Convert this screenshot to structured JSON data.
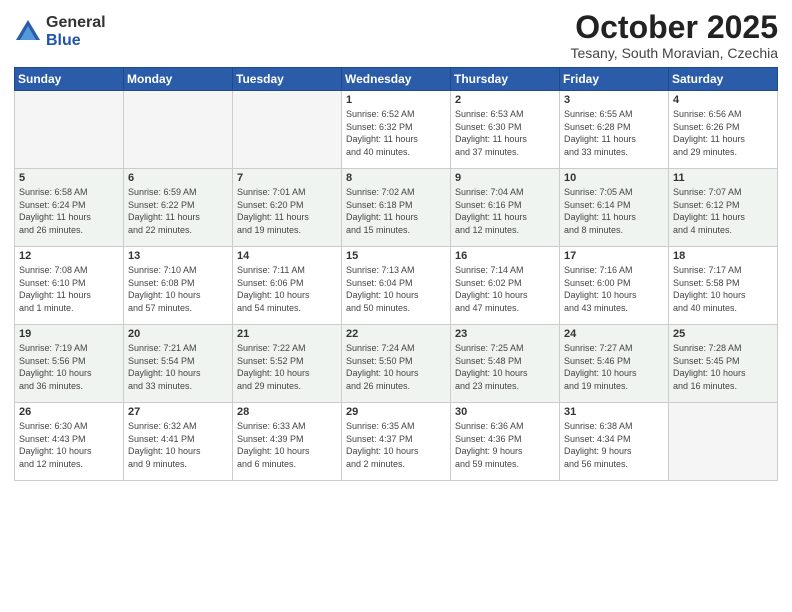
{
  "header": {
    "logo_general": "General",
    "logo_blue": "Blue",
    "month_year": "October 2025",
    "location": "Tesany, South Moravian, Czechia"
  },
  "calendar": {
    "days_of_week": [
      "Sunday",
      "Monday",
      "Tuesday",
      "Wednesday",
      "Thursday",
      "Friday",
      "Saturday"
    ],
    "weeks": [
      [
        {
          "day": "",
          "info": ""
        },
        {
          "day": "",
          "info": ""
        },
        {
          "day": "",
          "info": ""
        },
        {
          "day": "1",
          "info": "Sunrise: 6:52 AM\nSunset: 6:32 PM\nDaylight: 11 hours\nand 40 minutes."
        },
        {
          "day": "2",
          "info": "Sunrise: 6:53 AM\nSunset: 6:30 PM\nDaylight: 11 hours\nand 37 minutes."
        },
        {
          "day": "3",
          "info": "Sunrise: 6:55 AM\nSunset: 6:28 PM\nDaylight: 11 hours\nand 33 minutes."
        },
        {
          "day": "4",
          "info": "Sunrise: 6:56 AM\nSunset: 6:26 PM\nDaylight: 11 hours\nand 29 minutes."
        }
      ],
      [
        {
          "day": "5",
          "info": "Sunrise: 6:58 AM\nSunset: 6:24 PM\nDaylight: 11 hours\nand 26 minutes."
        },
        {
          "day": "6",
          "info": "Sunrise: 6:59 AM\nSunset: 6:22 PM\nDaylight: 11 hours\nand 22 minutes."
        },
        {
          "day": "7",
          "info": "Sunrise: 7:01 AM\nSunset: 6:20 PM\nDaylight: 11 hours\nand 19 minutes."
        },
        {
          "day": "8",
          "info": "Sunrise: 7:02 AM\nSunset: 6:18 PM\nDaylight: 11 hours\nand 15 minutes."
        },
        {
          "day": "9",
          "info": "Sunrise: 7:04 AM\nSunset: 6:16 PM\nDaylight: 11 hours\nand 12 minutes."
        },
        {
          "day": "10",
          "info": "Sunrise: 7:05 AM\nSunset: 6:14 PM\nDaylight: 11 hours\nand 8 minutes."
        },
        {
          "day": "11",
          "info": "Sunrise: 7:07 AM\nSunset: 6:12 PM\nDaylight: 11 hours\nand 4 minutes."
        }
      ],
      [
        {
          "day": "12",
          "info": "Sunrise: 7:08 AM\nSunset: 6:10 PM\nDaylight: 11 hours\nand 1 minute."
        },
        {
          "day": "13",
          "info": "Sunrise: 7:10 AM\nSunset: 6:08 PM\nDaylight: 10 hours\nand 57 minutes."
        },
        {
          "day": "14",
          "info": "Sunrise: 7:11 AM\nSunset: 6:06 PM\nDaylight: 10 hours\nand 54 minutes."
        },
        {
          "day": "15",
          "info": "Sunrise: 7:13 AM\nSunset: 6:04 PM\nDaylight: 10 hours\nand 50 minutes."
        },
        {
          "day": "16",
          "info": "Sunrise: 7:14 AM\nSunset: 6:02 PM\nDaylight: 10 hours\nand 47 minutes."
        },
        {
          "day": "17",
          "info": "Sunrise: 7:16 AM\nSunset: 6:00 PM\nDaylight: 10 hours\nand 43 minutes."
        },
        {
          "day": "18",
          "info": "Sunrise: 7:17 AM\nSunset: 5:58 PM\nDaylight: 10 hours\nand 40 minutes."
        }
      ],
      [
        {
          "day": "19",
          "info": "Sunrise: 7:19 AM\nSunset: 5:56 PM\nDaylight: 10 hours\nand 36 minutes."
        },
        {
          "day": "20",
          "info": "Sunrise: 7:21 AM\nSunset: 5:54 PM\nDaylight: 10 hours\nand 33 minutes."
        },
        {
          "day": "21",
          "info": "Sunrise: 7:22 AM\nSunset: 5:52 PM\nDaylight: 10 hours\nand 29 minutes."
        },
        {
          "day": "22",
          "info": "Sunrise: 7:24 AM\nSunset: 5:50 PM\nDaylight: 10 hours\nand 26 minutes."
        },
        {
          "day": "23",
          "info": "Sunrise: 7:25 AM\nSunset: 5:48 PM\nDaylight: 10 hours\nand 23 minutes."
        },
        {
          "day": "24",
          "info": "Sunrise: 7:27 AM\nSunset: 5:46 PM\nDaylight: 10 hours\nand 19 minutes."
        },
        {
          "day": "25",
          "info": "Sunrise: 7:28 AM\nSunset: 5:45 PM\nDaylight: 10 hours\nand 16 minutes."
        }
      ],
      [
        {
          "day": "26",
          "info": "Sunrise: 6:30 AM\nSunset: 4:43 PM\nDaylight: 10 hours\nand 12 minutes."
        },
        {
          "day": "27",
          "info": "Sunrise: 6:32 AM\nSunset: 4:41 PM\nDaylight: 10 hours\nand 9 minutes."
        },
        {
          "day": "28",
          "info": "Sunrise: 6:33 AM\nSunset: 4:39 PM\nDaylight: 10 hours\nand 6 minutes."
        },
        {
          "day": "29",
          "info": "Sunrise: 6:35 AM\nSunset: 4:37 PM\nDaylight: 10 hours\nand 2 minutes."
        },
        {
          "day": "30",
          "info": "Sunrise: 6:36 AM\nSunset: 4:36 PM\nDaylight: 9 hours\nand 59 minutes."
        },
        {
          "day": "31",
          "info": "Sunrise: 6:38 AM\nSunset: 4:34 PM\nDaylight: 9 hours\nand 56 minutes."
        },
        {
          "day": "",
          "info": ""
        }
      ]
    ]
  }
}
